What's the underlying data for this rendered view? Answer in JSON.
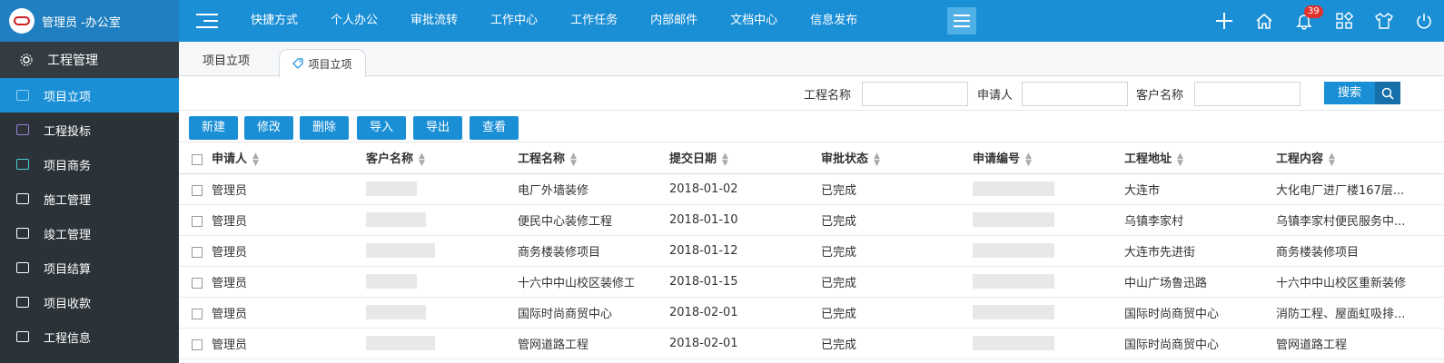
{
  "brand": {
    "title": "管理员 -办公室"
  },
  "nav": {
    "items": [
      "快捷方式",
      "个人办公",
      "审批流转",
      "工作中心",
      "工作任务",
      "内部邮件",
      "文档中心",
      "信息发布"
    ]
  },
  "top_icons": {
    "notification_count": "39"
  },
  "sidebar": {
    "header": "工程管理",
    "items": [
      "项目立项",
      "工程投标",
      "项目商务",
      "施工管理",
      "竣工管理",
      "项目结算",
      "项目收款",
      "工程信息"
    ]
  },
  "tabs": {
    "items": [
      "项目立项",
      "项目立项"
    ]
  },
  "search": {
    "labels": [
      "工程名称",
      "申请人",
      "客户名称"
    ],
    "button": "搜索"
  },
  "toolbar": {
    "buttons": [
      "新建",
      "修改",
      "删除",
      "导入",
      "导出",
      "查看"
    ]
  },
  "table": {
    "headers": [
      "申请人",
      "客户名称",
      "工程名称",
      "提交日期",
      "审批状态",
      "申请编号",
      "工程地址",
      "工程内容"
    ],
    "rows": [
      {
        "applicant": "管理员",
        "project": "电厂外墙装修",
        "date": "2018-01-02",
        "status": "已完成",
        "address": "大连市",
        "content": "大化电厂进厂楼167层..."
      },
      {
        "applicant": "管理员",
        "project": "便民中心装修工程",
        "date": "2018-01-10",
        "status": "已完成",
        "address": "乌镇李家村",
        "content": "乌镇李家村便民服务中..."
      },
      {
        "applicant": "管理员",
        "project": "商务楼装修项目",
        "date": "2018-01-12",
        "status": "已完成",
        "address": "大连市先进街",
        "content": "商务楼装修项目"
      },
      {
        "applicant": "管理员",
        "project": "十六中中山校区装修工程",
        "date": "2018-01-15",
        "status": "已完成",
        "address": "中山广场鲁迅路",
        "content": "十六中中山校区重新装修"
      },
      {
        "applicant": "管理员",
        "project": "国际时尚商贸中心",
        "date": "2018-02-01",
        "status": "已完成",
        "address": "国际时尚商贸中心",
        "content": "消防工程、屋面虹吸排..."
      },
      {
        "applicant": "管理员",
        "project": "管网道路工程",
        "date": "2018-02-01",
        "status": "已完成",
        "address": "国际时尚商贸中心",
        "content": "管网道路工程"
      }
    ]
  },
  "colors": {
    "primary": "#1a8fd6",
    "sidebar": "#2b3338"
  }
}
